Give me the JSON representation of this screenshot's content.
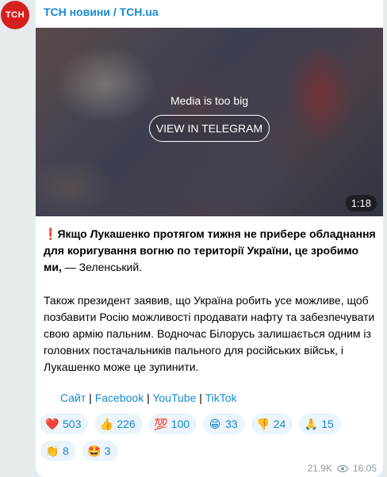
{
  "channel": {
    "avatar_text": "ТСН",
    "name": "ТСН новини / TCH.ua"
  },
  "media": {
    "notice": "Media is too big",
    "button_label": "VIEW IN TELEGRAM",
    "duration": "1:18"
  },
  "post": {
    "excl_icon": "❗",
    "bold_text": "Якщо Лукашенко протягом тижня не прибере обладнання для коригування вогню по території України, це зробимо ми,",
    "attribution": " — Зеленський.",
    "paragraph2": "Також президент заявив, що Україна робить усе можливе, щоб позбавити Росію можливості продавати нафту та забезпечувати свою армію пальним. Водночас Білорусь залишається одним із головних постачальників пального для російських військ, і Лукашенко може це зупинити."
  },
  "links": [
    "Сайт",
    "Facebook",
    "YouTube",
    "TikTok"
  ],
  "link_separator": " | ",
  "reactions": [
    {
      "emoji": "❤️",
      "icon": "red-heart",
      "count": "503"
    },
    {
      "emoji": "👍",
      "icon": "thumbs-up",
      "count": "226"
    },
    {
      "emoji": "💯",
      "icon": "hundred-points",
      "count": "100"
    },
    {
      "emoji": "😁",
      "icon": "grinning-face",
      "count": "33"
    },
    {
      "emoji": "👎",
      "icon": "thumbs-down",
      "count": "24"
    },
    {
      "emoji": "🙏",
      "icon": "folded-hands",
      "count": "15"
    },
    {
      "emoji": "👏",
      "icon": "clapping-hands",
      "count": "8"
    },
    {
      "emoji": "🤩",
      "icon": "star-struck",
      "count": "3"
    }
  ],
  "meta": {
    "views": "21.9K",
    "time": "16:05"
  },
  "colors": {
    "accent": "#168acd",
    "avatar_bg": "#d6201f",
    "reaction_bg": "#ebf3fb",
    "background": "#e6ebee"
  }
}
